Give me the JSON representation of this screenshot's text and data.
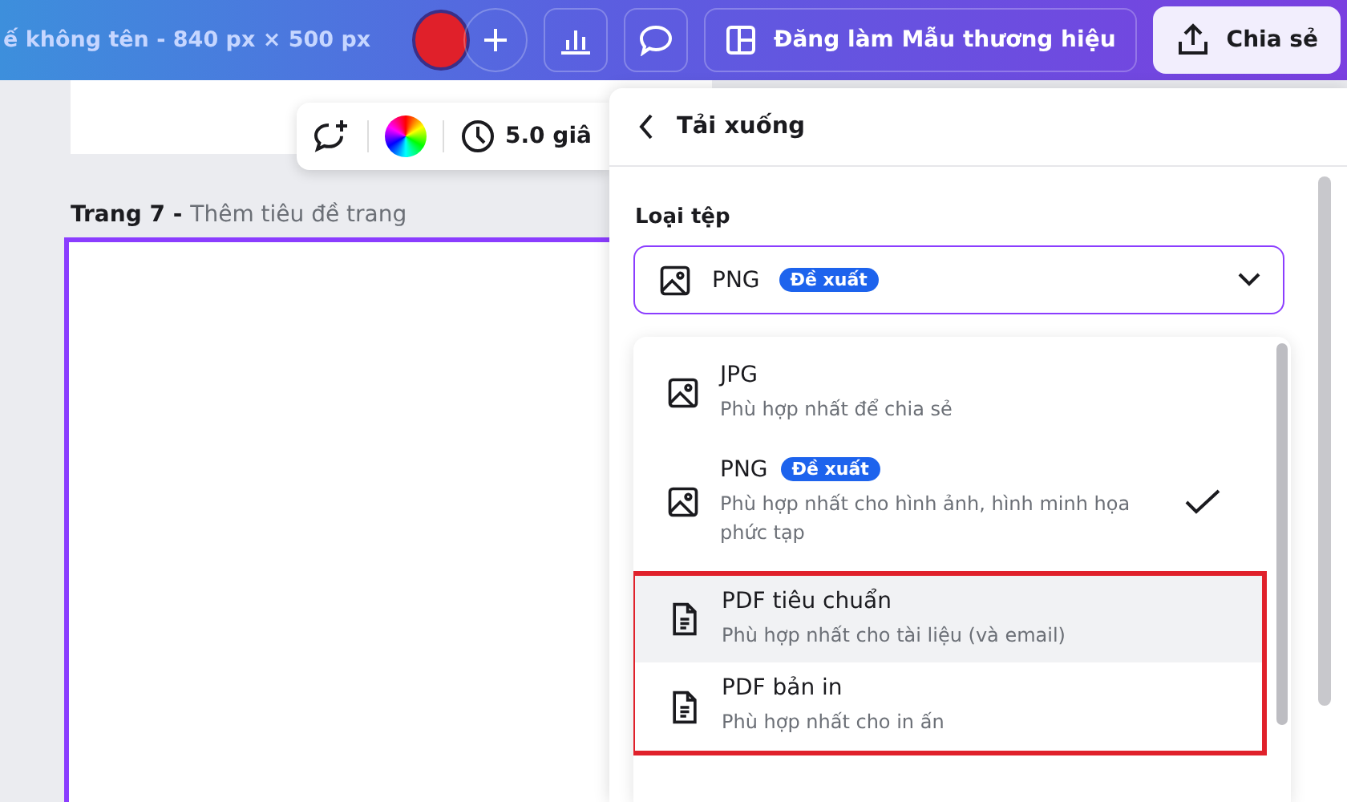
{
  "topbar": {
    "title": "ế không tên - 840 px × 500 px",
    "brand_button": "Đăng làm Mẫu thương hiệu",
    "share_button": "Chia sẻ"
  },
  "toolbar": {
    "duration": "5.0 giâ"
  },
  "page": {
    "number_label": "Trang 7 -",
    "title_placeholder": "Thêm tiêu đề trang"
  },
  "download_panel": {
    "title": "Tải xuống",
    "file_type_label": "Loại tệp",
    "selected_type": {
      "label": "PNG",
      "badge": "Đề xuất"
    },
    "expanded": true,
    "options": [
      {
        "kind": "image",
        "label": "JPG",
        "description": "Phù hợp nhất để chia sẻ",
        "selected": false,
        "hovered": false,
        "highlighted": false
      },
      {
        "kind": "image",
        "label": "PNG",
        "badge": "Đề xuất",
        "description": "Phù hợp nhất cho hình ảnh, hình minh họa phức tạp",
        "selected": true,
        "hovered": false,
        "highlighted": false
      },
      {
        "kind": "document",
        "label": "PDF tiêu chuẩn",
        "description": "Phù hợp nhất cho tài liệu (và email)",
        "selected": false,
        "hovered": true,
        "highlighted": true
      },
      {
        "kind": "document",
        "label": "PDF bản in",
        "description": "Phù hợp nhất cho in ấn",
        "selected": false,
        "hovered": false,
        "highlighted": true
      }
    ]
  }
}
